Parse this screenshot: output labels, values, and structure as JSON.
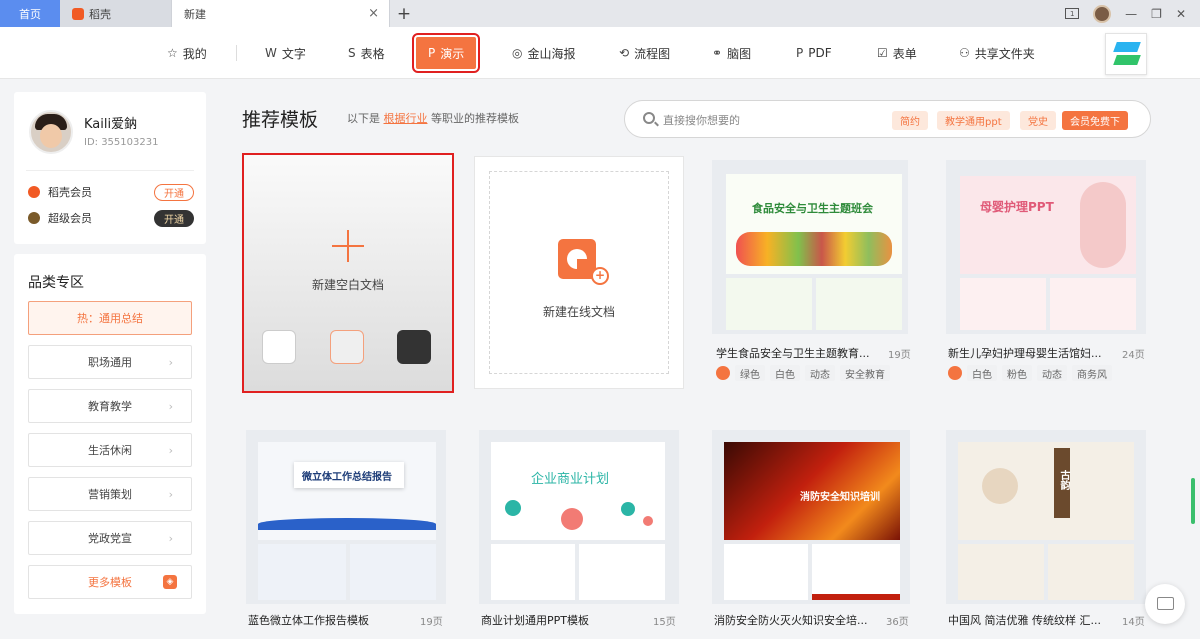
{
  "tabs": {
    "home": "首页",
    "daoke": "稻壳",
    "new": "新建",
    "close": "×",
    "add": "+"
  },
  "window": {
    "layout_label": "1"
  },
  "toolbar": {
    "items": [
      {
        "glyph": "☆",
        "label": "我的"
      },
      {
        "glyph": "W",
        "label": "文字"
      },
      {
        "glyph": "S",
        "label": "表格"
      },
      {
        "glyph": "P",
        "label": "演示"
      },
      {
        "glyph": "◎",
        "label": "金山海报"
      },
      {
        "glyph": "⟲",
        "label": "流程图"
      },
      {
        "glyph": "⚭",
        "label": "脑图"
      },
      {
        "glyph": "P",
        "label": "PDF"
      },
      {
        "glyph": "☑",
        "label": "表单"
      },
      {
        "glyph": "⚇",
        "label": "共享文件夹"
      }
    ],
    "active": "演示"
  },
  "user": {
    "name": "Kaili爱鈉",
    "id": "ID: 355103231"
  },
  "membership": [
    {
      "label": "稻壳会员",
      "button": "开通",
      "icon_color": "#f15a24"
    },
    {
      "label": "超级会员",
      "button": "开通",
      "icon_color": "#7a5a2a"
    }
  ],
  "categories": {
    "title": "品类专区",
    "hot": "热：通用总结",
    "items": [
      "职场通用",
      "教育教学",
      "生活休闲",
      "营销策划",
      "党政党宣"
    ],
    "more": "更多模板"
  },
  "main": {
    "title": "推荐模板",
    "subtitle_prefix": "以下是",
    "subtitle_link": "根据行业",
    "subtitle_suffix": "等职业的推荐模板"
  },
  "search": {
    "placeholder": "直接搜你想要的",
    "chips": [
      "简约",
      "教学通用ppt",
      "党史",
      "会员免费下"
    ]
  },
  "new_blank": {
    "label": "新建空白文档"
  },
  "new_online": {
    "label": "新建在线文档"
  },
  "templates": [
    {
      "title": "学生食品安全与卫生主题教育...",
      "pages": "19页",
      "tags": [
        "绿色",
        "白色",
        "动态",
        "安全教育"
      ],
      "slide_title": "食品安全与卫生主题班会"
    },
    {
      "title": "新生儿孕妇护理母婴生活馆妇...",
      "pages": "24页",
      "tags": [
        "白色",
        "粉色",
        "动态",
        "商务风"
      ],
      "slide_title": "母婴护理PPT"
    },
    {
      "title": "蓝色微立体工作报告模板",
      "pages": "19页",
      "tags": [],
      "slide_title": "微立体工作总结报告"
    },
    {
      "title": "商业计划通用PPT模板",
      "pages": "15页",
      "tags": [],
      "slide_title": "企业商业计划"
    },
    {
      "title": "消防安全防火灭火知识安全培...",
      "pages": "36页",
      "tags": [],
      "slide_title": "消防安全知识培训"
    },
    {
      "title": "中国风 简洁优雅 传统纹样 汇...",
      "pages": "14页",
      "tags": [],
      "slide_title": "古韵"
    }
  ],
  "colors": {
    "accent": "#f47440",
    "highlight": "#e02020",
    "tab_home": "#5b8def"
  }
}
